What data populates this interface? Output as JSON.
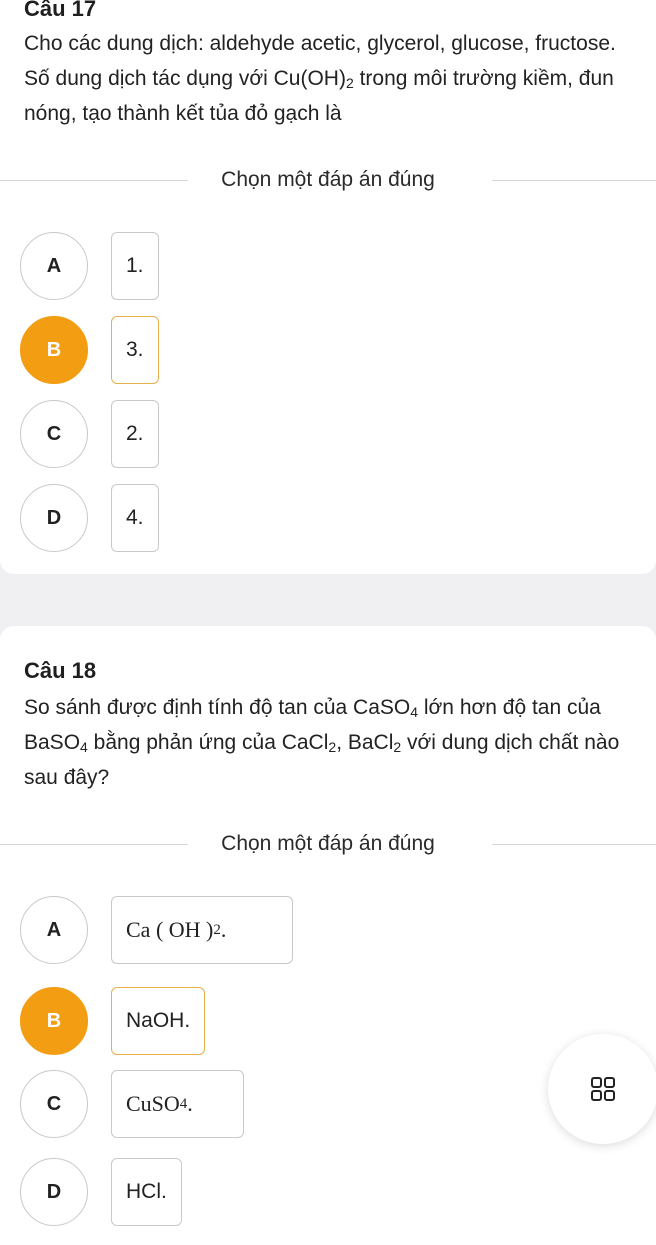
{
  "q17": {
    "title": "Câu 17",
    "text_before": "Cho các dung dịch: aldehyde acetic, glycerol, glucose, fructose. Số dung dịch tác dụng với Cu(OH)",
    "text_sub": "2",
    "text_after": " trong môi trường kiềm, đun nóng, tạo thành kết tủa đỏ gạch là",
    "prompt": "Chọn một đáp án đúng",
    "options": [
      {
        "letter": "A",
        "text": "1."
      },
      {
        "letter": "B",
        "text": "3."
      },
      {
        "letter": "C",
        "text": "2."
      },
      {
        "letter": "D",
        "text": "4."
      }
    ],
    "selected": "B"
  },
  "q18": {
    "title": "Câu 18",
    "text_parts": [
      "So sánh được định tính độ tan của CaSO",
      "4",
      " lớn hơn độ tan của BaSO",
      "4",
      " bằng phản ứng của CaCl",
      "2",
      ", BaCl",
      "2",
      " với dung dịch chất nào sau đây?"
    ],
    "prompt": "Chọn một đáp án đúng",
    "options": [
      {
        "letter": "A",
        "text_main": "Ca ( OH ) ",
        "text_sub": "2",
        "text_end": "."
      },
      {
        "letter": "B",
        "text": "NaOH."
      },
      {
        "letter": "C",
        "text_main": "CuSO ",
        "text_sub": "4",
        "text_end": "."
      },
      {
        "letter": "D",
        "text": "HCl."
      }
    ],
    "selected": "B"
  },
  "fab_icon": "grid-icon",
  "colors": {
    "accent": "#f29d12",
    "selected_border": "#e7b04a"
  }
}
